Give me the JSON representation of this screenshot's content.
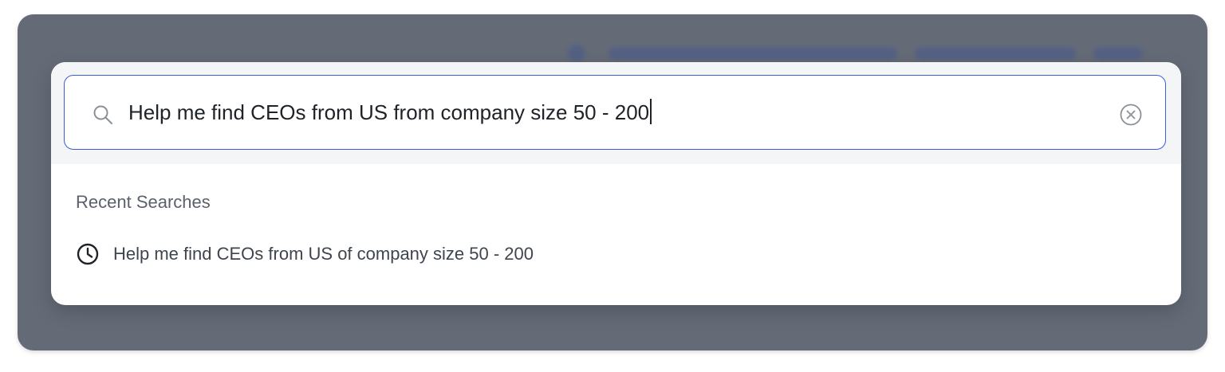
{
  "search": {
    "value": "Help me find CEOs from US from company size 50 - 200",
    "search_icon": "search-icon",
    "clear_icon": "clear-circle-x-icon"
  },
  "recent": {
    "heading": "Recent Searches",
    "items": [
      {
        "label": "Help me find CEOs from US of company size 50 - 200",
        "icon": "clock-icon"
      }
    ]
  },
  "colors": {
    "backdrop": "#646b77",
    "modal_background": "#ffffff",
    "modal_top_background": "#f4f5f7",
    "input_focus_border": "#3b5bdb",
    "text_primary": "#1f2328",
    "text_secondary": "#5b616b"
  }
}
